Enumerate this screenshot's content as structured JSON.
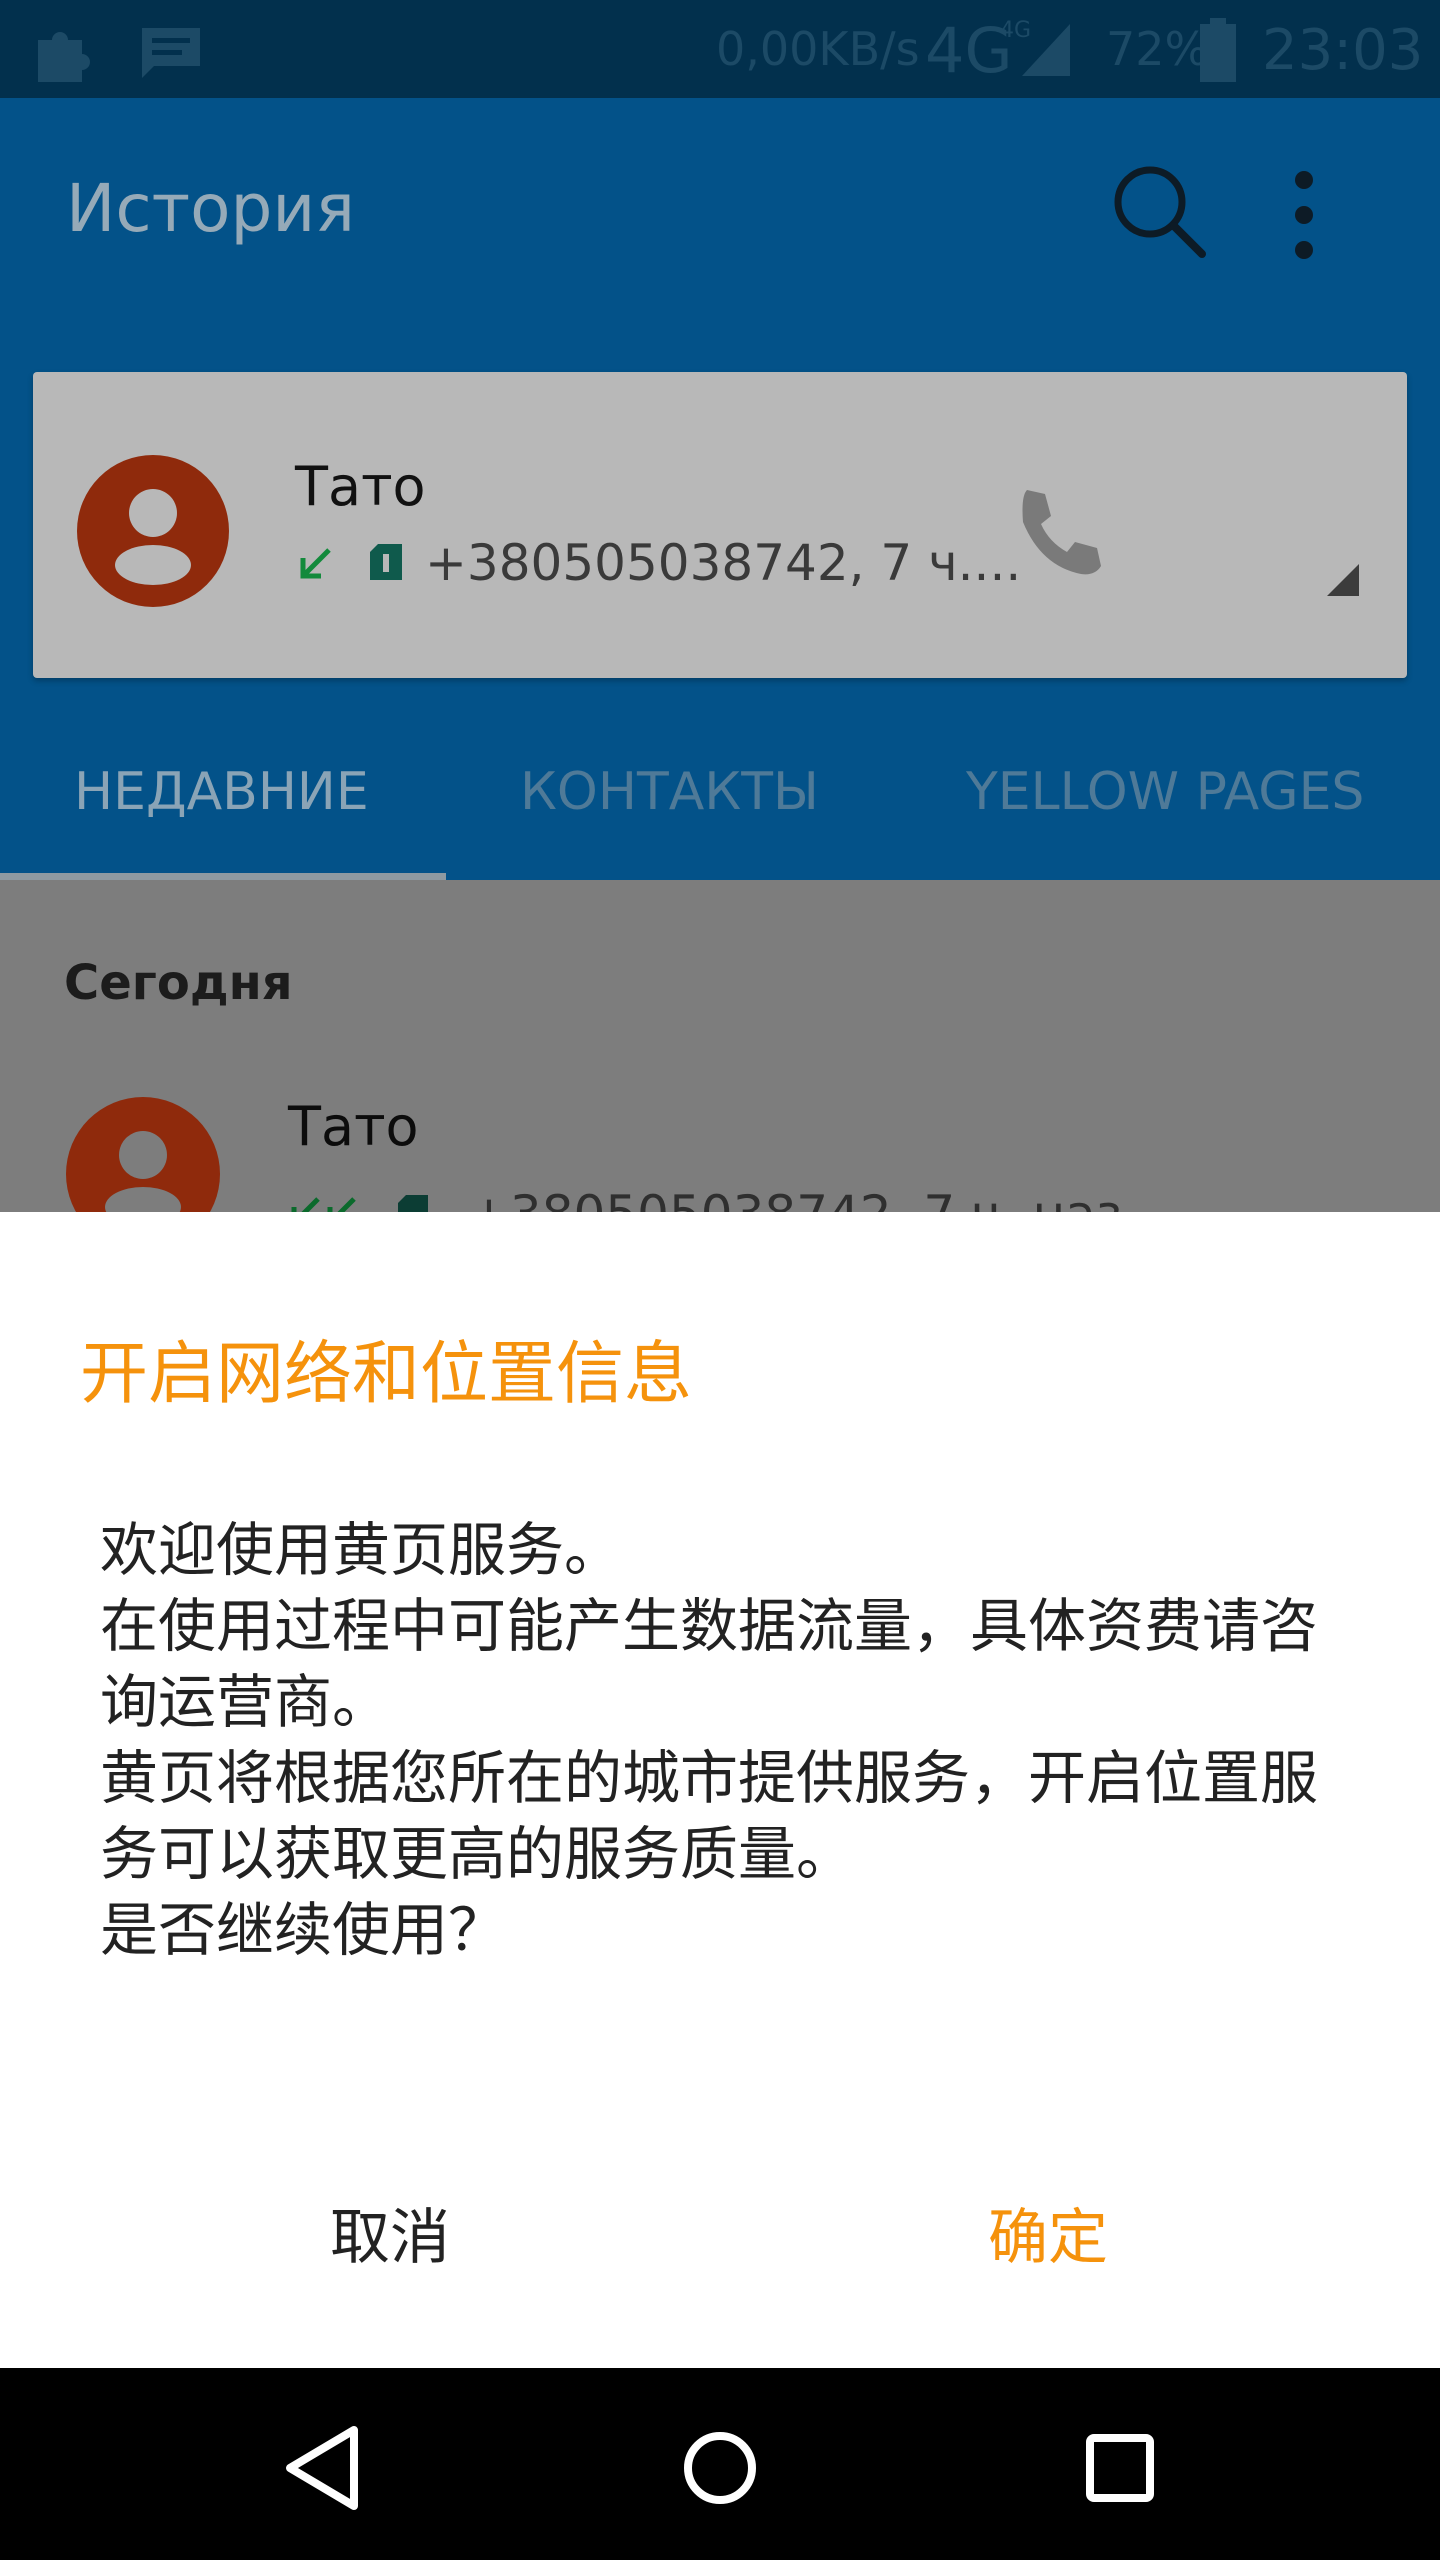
{
  "status_bar": {
    "speed": "0,00KB/s",
    "network": "4G",
    "network_small": "4G",
    "battery": "72%",
    "time": "23:03",
    "icons": [
      "puzzle-icon",
      "message-icon",
      "signal-icon",
      "battery-icon"
    ]
  },
  "app_bar": {
    "title": "История"
  },
  "recent_card": {
    "name": "Тато",
    "detail": "+380505038742, 7 ч...."
  },
  "tabs": [
    "НЕДАВНИЕ",
    "КОНТАКТЫ",
    "YELLOW PAGES"
  ],
  "list": {
    "section": "Сегодня",
    "rows": [
      {
        "name": "Тато",
        "detail": "+380505038742, 7 ч. наз"
      }
    ]
  },
  "dialog": {
    "title": "开启网络和位置信息",
    "message": "欢迎使用黄页服务。\n在使用过程中可能产生数据流量，具体资费请咨询运营商。\n黄页将根据您所在的城市提供服务，开启位置服务可以获取更高的服务质量。\n是否继续使用？",
    "cancel": "取消",
    "confirm": "确定"
  },
  "colors": {
    "accent": "#f5920c",
    "app_bar": "#035289",
    "status_bar": "#02304d",
    "avatar": "#8f2a0c",
    "incoming_call": "#138a3c"
  }
}
